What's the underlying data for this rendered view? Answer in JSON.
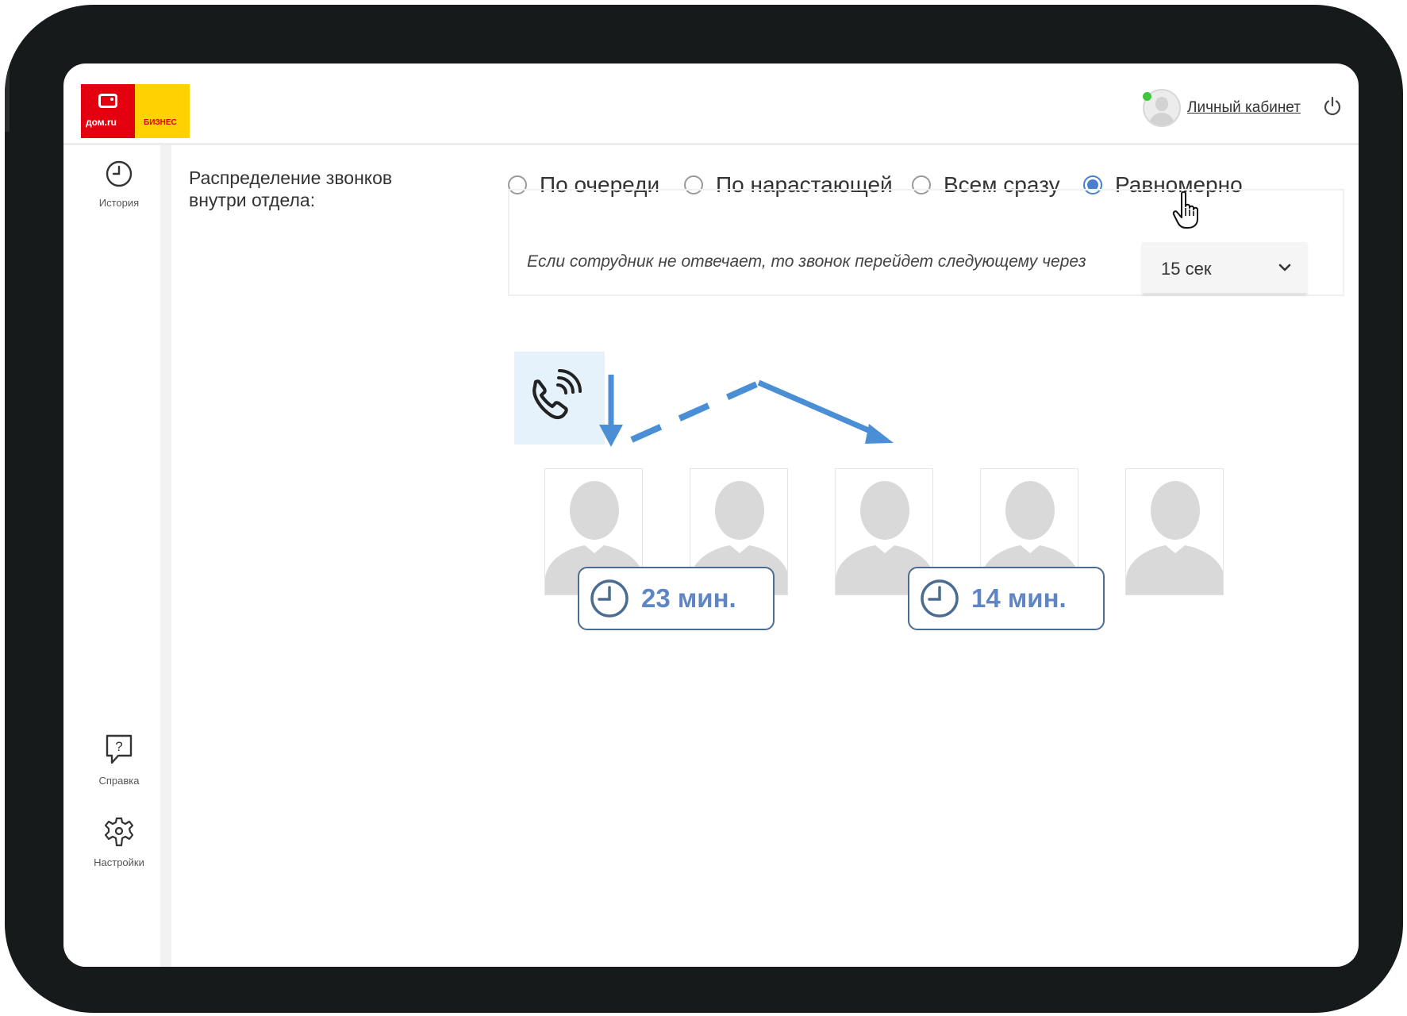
{
  "header": {
    "logo": {
      "brand": "дом.ru",
      "sub": "БИЗНЕС"
    },
    "account_label": "Личный кабинет"
  },
  "sidebar": {
    "items": [
      {
        "label": "История",
        "icon": "clock-icon"
      },
      {
        "label": "Справка",
        "icon": "help-icon"
      },
      {
        "label": "Настройки",
        "icon": "gear-icon"
      }
    ]
  },
  "distribution": {
    "label": "Распределение звонков внутри отдела:",
    "options": [
      {
        "label": "По очереди",
        "checked": false
      },
      {
        "label": "По нарастающей",
        "checked": false
      },
      {
        "label": "Всем сразу",
        "checked": false
      },
      {
        "label": "Равномерно",
        "checked": true
      }
    ],
    "timeout_text": "Если сотрудник не отвечает, то звонок перейдет следующему через",
    "timeout_value": "15 сек"
  },
  "diagram": {
    "employees_count": 5,
    "timers": [
      {
        "text": "23 мин."
      },
      {
        "text": "14 мин."
      }
    ]
  },
  "colors": {
    "accent": "#4a7fd0",
    "arrow": "#4a8fd6",
    "timer_text": "#5f86c4",
    "brand_red": "#e3000f",
    "brand_yellow": "#ffd200"
  }
}
